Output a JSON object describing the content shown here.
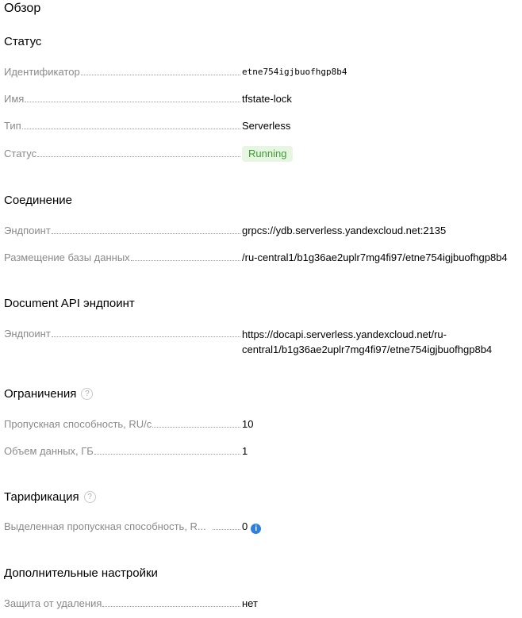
{
  "page": {
    "title": "Обзор"
  },
  "status": {
    "title": "Статус",
    "rows": [
      {
        "label": "Идентификатор",
        "value": "etne754igjbuofhgp8b4"
      },
      {
        "label": "Имя",
        "value": "tfstate-lock"
      },
      {
        "label": "Тип",
        "value": "Serverless"
      },
      {
        "label": "Статус",
        "value": "Running"
      }
    ],
    "status_color": "#3c9c30"
  },
  "connection": {
    "title": "Соединение",
    "rows": [
      {
        "label": "Эндпоинт",
        "value": "grpcs://ydb.serverless.yandexcloud.net:2135"
      },
      {
        "label": "Размещение базы данных",
        "value": "/ru-central1/b1g36ae2uplr7mg4fi97/etne754igjbuofhgp8b4"
      }
    ]
  },
  "document_api": {
    "title": "Document API эндпоинт",
    "rows": [
      {
        "label": "Эндпоинт",
        "value": "https://docapi.serverless.yandexcloud.net/ru-central1/b1g36ae2uplr7mg4fi97/etne754igjbuofhgp8b4"
      }
    ]
  },
  "limits": {
    "title": "Ограничения",
    "rows": [
      {
        "label": "Пропускная способность, RU/c",
        "value": "10"
      },
      {
        "label": "Объем данных, ГБ",
        "value": "1"
      }
    ]
  },
  "billing": {
    "title": "Тарификация",
    "rows": [
      {
        "label": "Выделенная пропускная способность, R...",
        "value": "0"
      }
    ]
  },
  "advanced": {
    "title": "Дополнительные настройки",
    "rows": [
      {
        "label": "Защита от удаления",
        "value": "нет"
      }
    ]
  },
  "icons": {
    "help": "question-circle-icon",
    "info": "info-circle-icon"
  }
}
